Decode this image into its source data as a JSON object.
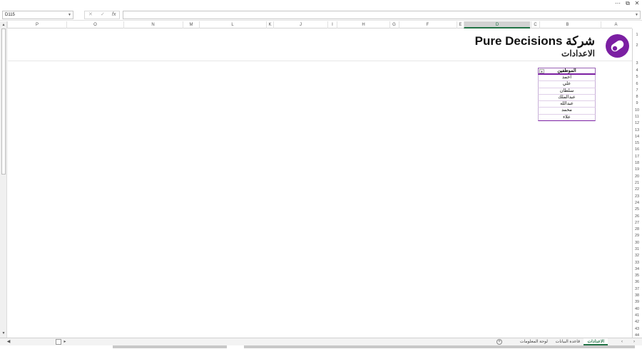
{
  "name_box": {
    "value": "D115"
  },
  "formula_bar": {
    "cancel": "✕",
    "confirm": "✓",
    "fx": "fx",
    "value": ""
  },
  "columns": [
    "A",
    "B",
    "C",
    "D",
    "E",
    "F",
    "G",
    "H",
    "I",
    "J",
    "K",
    "L",
    "M",
    "N",
    "O",
    "P"
  ],
  "active_column": "D",
  "rows": [
    "1",
    "2",
    "3",
    "4",
    "5",
    "6",
    "7",
    "8",
    "9",
    "10",
    "11",
    "12",
    "13",
    "14",
    "15",
    "16",
    "17",
    "18",
    "19",
    "20",
    "21",
    "22",
    "23",
    "24",
    "25",
    "26",
    "27",
    "28",
    "29",
    "30",
    "31",
    "32",
    "33",
    "34",
    "35",
    "36",
    "37",
    "38",
    "39",
    "40",
    "41",
    "42",
    "43",
    "44"
  ],
  "header": {
    "title": "شركة Pure Decisions",
    "subtitle": "الاعدادات",
    "logo_color": "#7b1fa2"
  },
  "employees_table": {
    "header": "الموظفين",
    "items": [
      "احمد",
      "علي",
      "سلطان",
      "عبدالملك",
      "عبدالله",
      "محمد",
      "علاء"
    ]
  },
  "sheet_tabs": [
    {
      "label": "الاعدادات",
      "active": true
    },
    {
      "label": "قاعدة البيانات",
      "active": false
    },
    {
      "label": "لوحة المعلومات",
      "active": false
    }
  ],
  "add_sheet": "+",
  "window_controls": {
    "more": "⋯",
    "restore": "⧉",
    "close": "✕"
  },
  "accent_color": "#217346"
}
